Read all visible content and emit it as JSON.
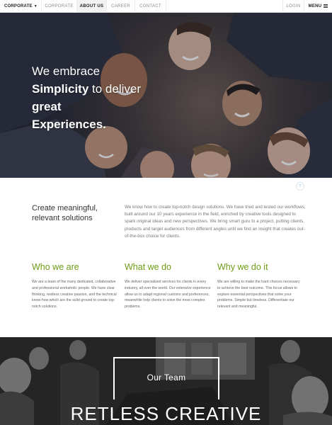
{
  "nav": {
    "brand": "CORPORATE",
    "links": [
      "CORPORATE",
      "ABOUT US",
      "CAREER",
      "CONTACT"
    ],
    "active": "ABOUT US",
    "login": "LOGIN",
    "menu": "MENU"
  },
  "hero": {
    "line1": "We embrace",
    "line2_bold": "Simplicity",
    "line2_rest": " to deliver",
    "line3": "great",
    "line4": "Experiences."
  },
  "intro": {
    "title": "Create meaningful, relevant solutions",
    "text": "We know how to create top-notch design solutions. We have tried and tested our workflows, built around our 10 years experience in the field, enriched by creative tools designed to spark original ideas and new perspectives. We bring smart guru to a project, putting clients, products and target audiences from different angles until we find an insight that creates out-of-the-box choice for clients."
  },
  "columns": [
    {
      "title": "Who we are",
      "text": "We are a team of the many dedicated, collaborative and professional workaholic people. We have clear thinking, restless creative passion, and the technical know-how which are the solid ground to create top-notch solutions."
    },
    {
      "title": "What we do",
      "text": "We deliver specialised services for clients in every industry, all over the world. Our extensive experience allow us to adapt regional customs and preferences, meanwhile help clients to solve the most complex problems."
    },
    {
      "title": "Why we do it",
      "text": "We are willing to make the hard choices necessary to achieve the best outcome. This focus allows to explore essential perspectives that solve your problems. Simple but timeless. Differentiate our relevant and meaningful."
    }
  ],
  "team": {
    "label": "Our Team",
    "headline": "RETLESS CREATIVE"
  },
  "colors": {
    "accent_green": "#6e9b16",
    "scroll_blue": "#3a8fd6"
  },
  "icons": {
    "caret": "chevron-down-icon",
    "menu": "hamburger-icon",
    "scroll": "arrow-up-icon"
  }
}
